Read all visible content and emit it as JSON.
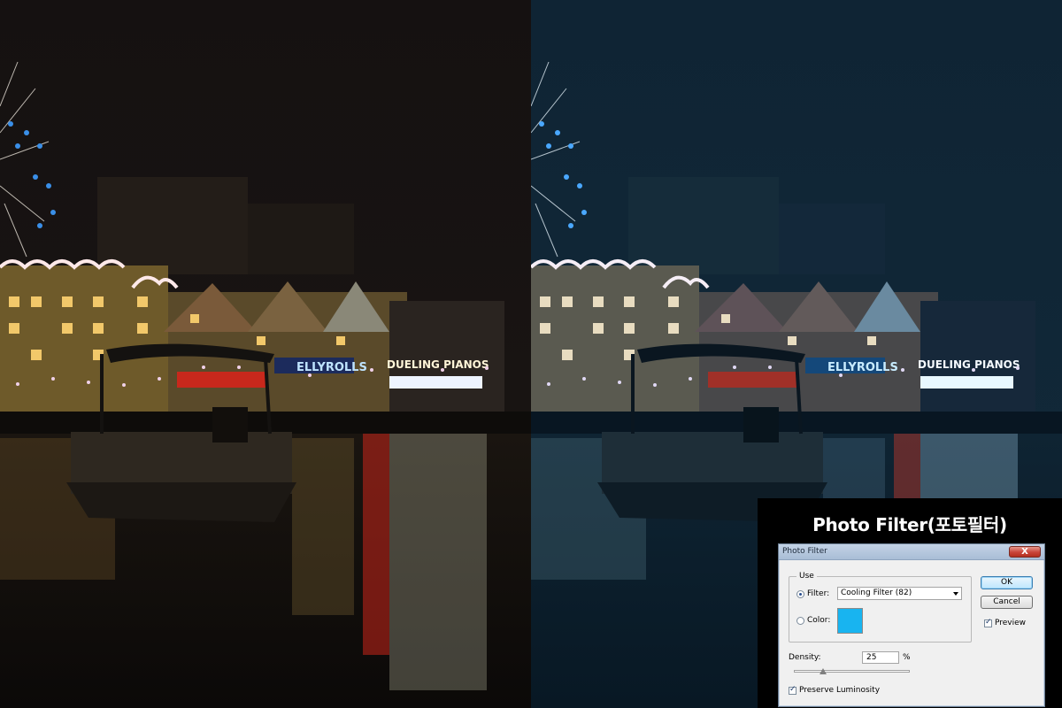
{
  "caption": "Photo Filter(포토필터)",
  "signs": {
    "left_sign": "ELLYROLLS",
    "right_sign": "DUELING PIANOS"
  },
  "dialog": {
    "title": "Photo Filter",
    "close_label": "X",
    "use_group_label": "Use",
    "filter_option_label": "Filter:",
    "filter_selected": "Cooling Filter (82)",
    "color_option_label": "Color:",
    "color_swatch_hex": "#18b4f0",
    "ok_label": "OK",
    "cancel_label": "Cancel",
    "preview_label": "Preview",
    "preview_checked": true,
    "density_label": "Density:",
    "density_value": "25",
    "density_unit": "%",
    "density_level": 0.25,
    "preserve_label": "Preserve Luminosity",
    "preserve_checked": true
  },
  "colors": {
    "original_sky": "#131010",
    "filtered_sky": "#0f2536",
    "filter_tint": "#1a86c8"
  }
}
